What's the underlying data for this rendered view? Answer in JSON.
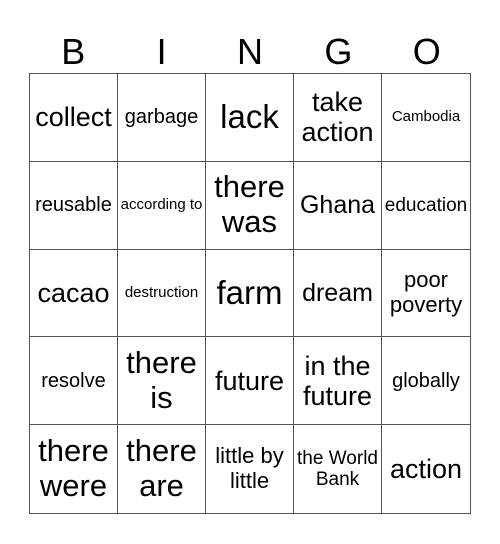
{
  "header": [
    "B",
    "I",
    "N",
    "G",
    "O"
  ],
  "cells": [
    [
      "collect",
      "garbage",
      "lack",
      "take action",
      "Cambodia"
    ],
    [
      "reusable",
      "according to",
      "there was",
      "Ghana",
      "education"
    ],
    [
      "cacao",
      "destruction",
      "farm",
      "dream",
      "poor poverty"
    ],
    [
      "resolve",
      "there is",
      "future",
      "in the future",
      "globally"
    ],
    [
      "there were",
      "there are",
      "little by little",
      "the World Bank",
      "action"
    ]
  ]
}
